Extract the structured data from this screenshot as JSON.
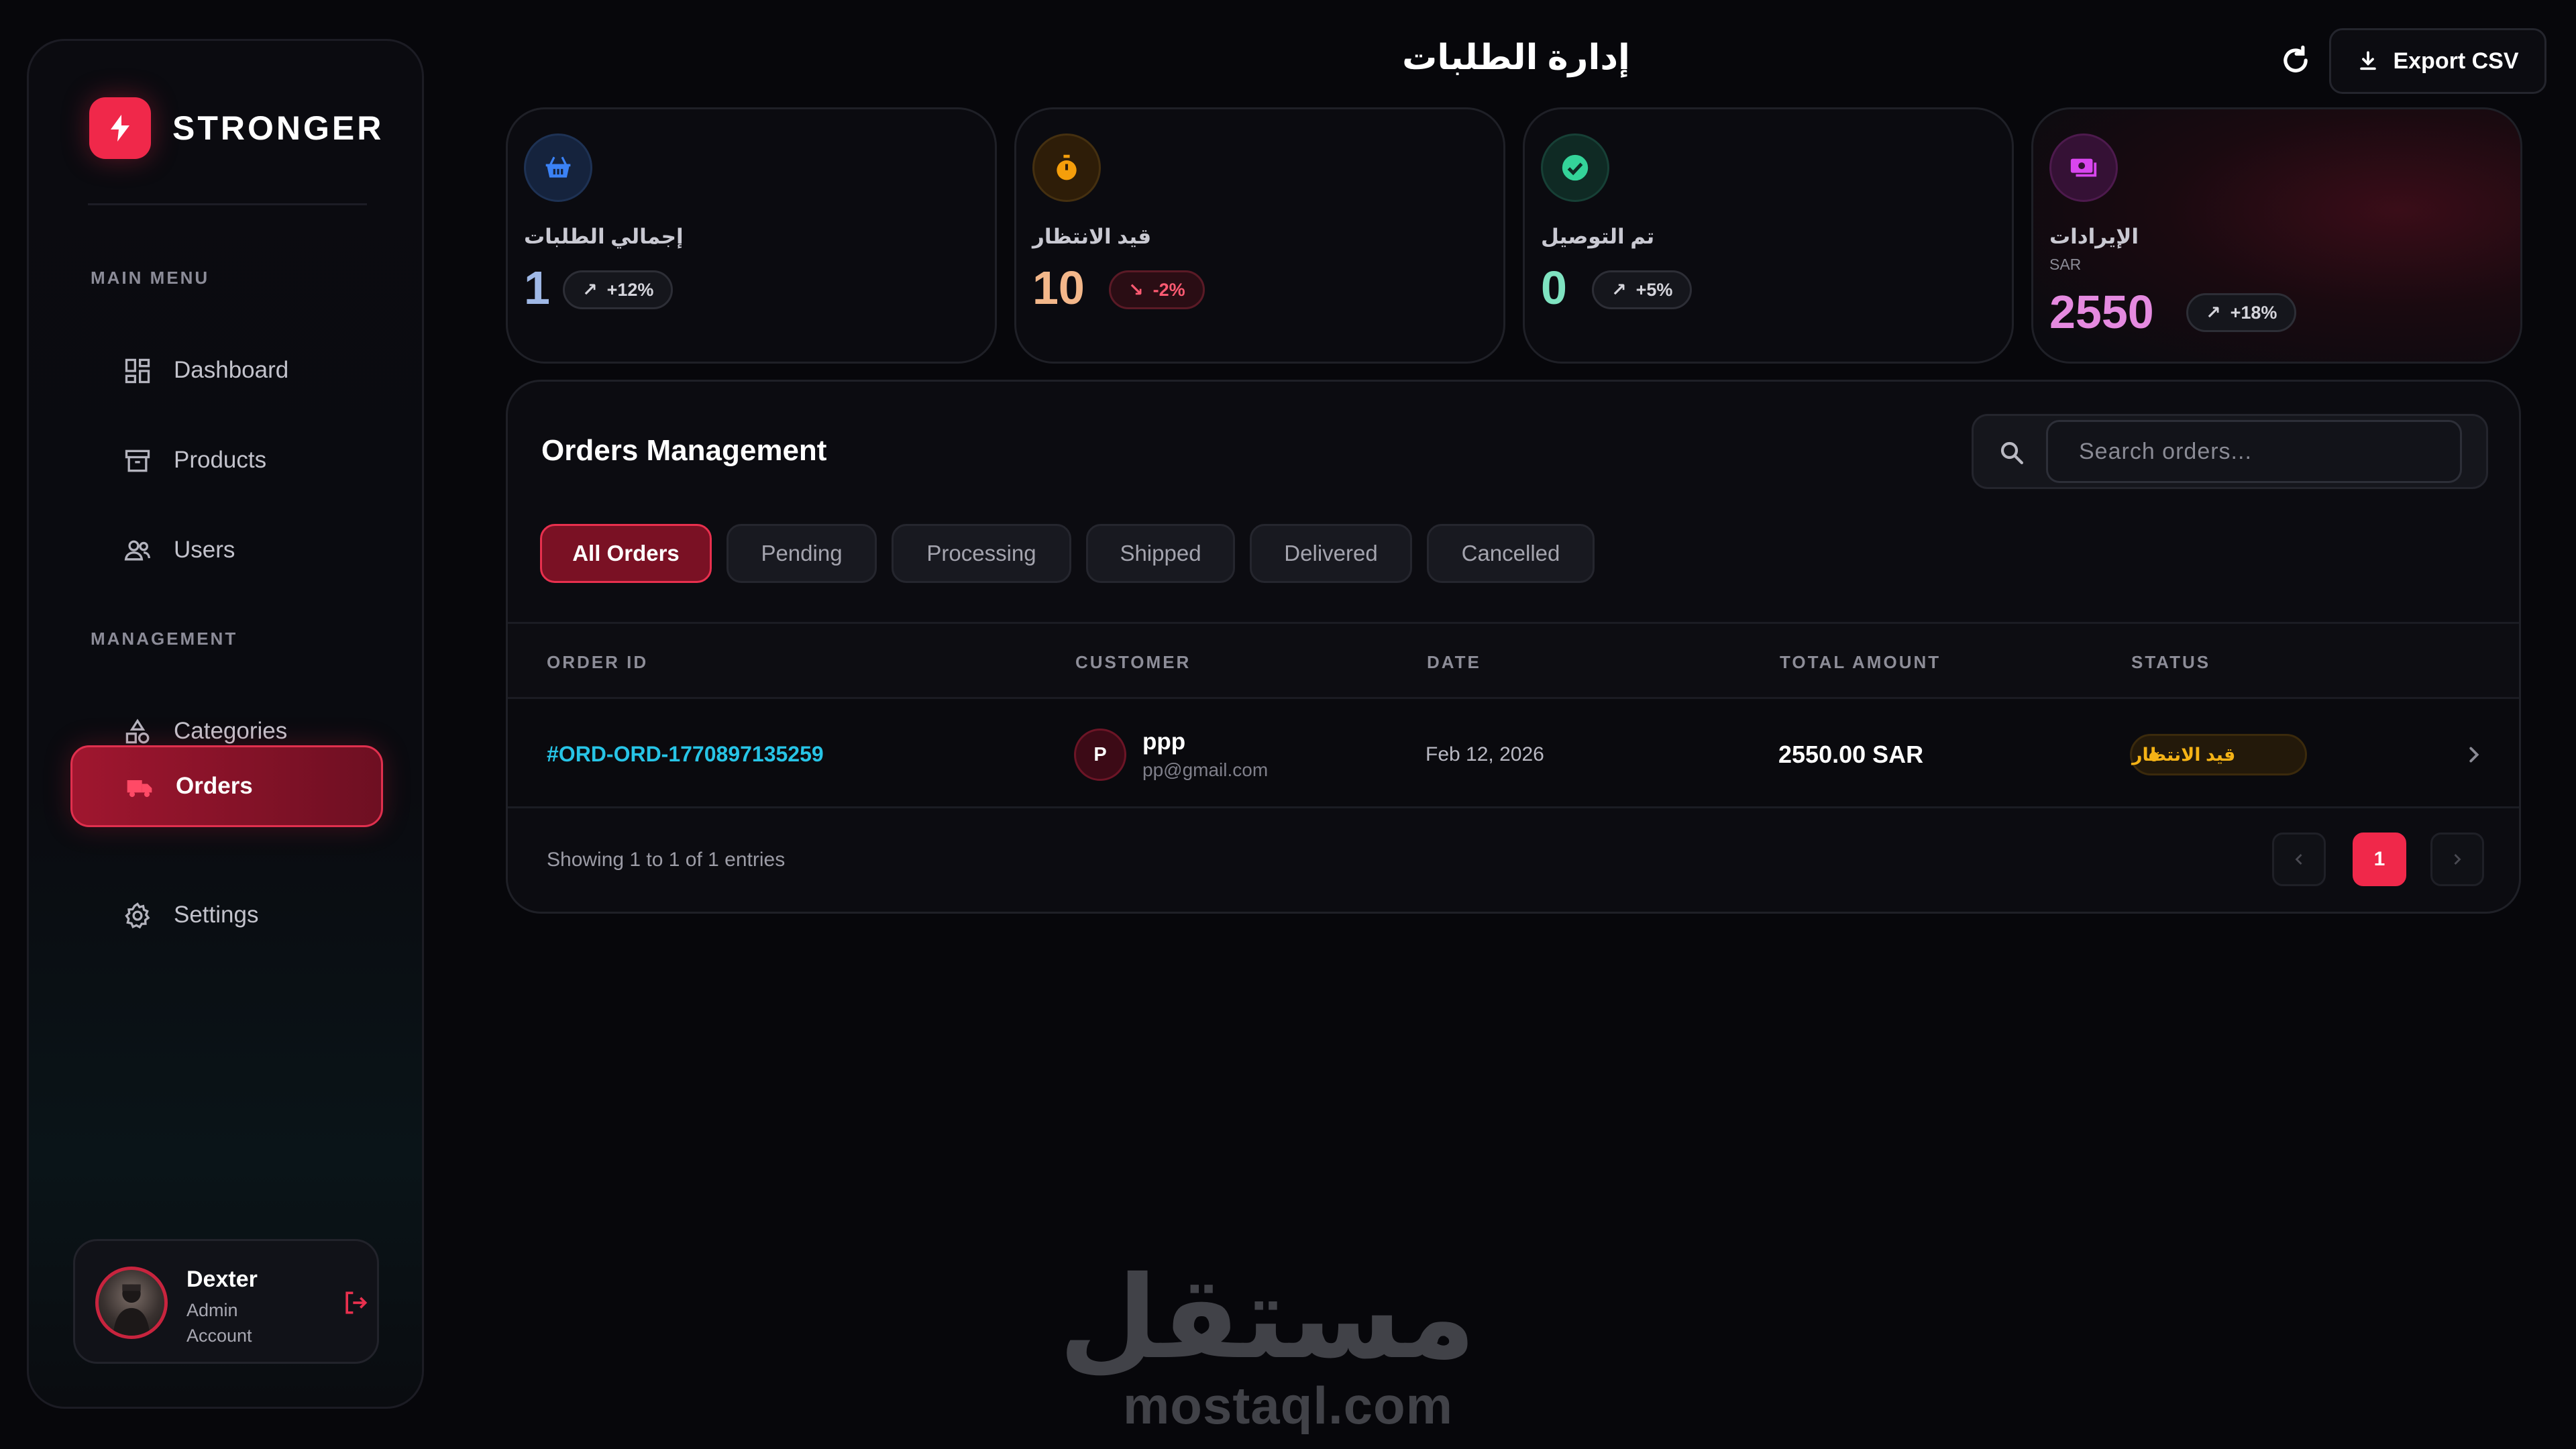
{
  "brand": {
    "name": "STRONGER",
    "accent": "#f0284a"
  },
  "sidebar": {
    "main_menu_label": "MAIN MENU",
    "management_label": "MANAGEMENT",
    "items": [
      {
        "label": "Dashboard",
        "icon": "dashboard-grid-icon"
      },
      {
        "label": "Products",
        "icon": "archive-box-icon"
      },
      {
        "label": "Users",
        "icon": "users-icon"
      },
      {
        "label": "Categories",
        "icon": "shapes-icon"
      },
      {
        "label": "Orders",
        "icon": "truck-icon",
        "active": true
      },
      {
        "label": "Settings",
        "icon": "gear-icon"
      }
    ],
    "user": {
      "name": "Dexter",
      "role": "Admin Account"
    }
  },
  "header": {
    "title": "إدارة الطلبات",
    "export_label": "Export CSV"
  },
  "stats": [
    {
      "label": "إجمالي الطلبات",
      "value": "1",
      "trend": "+12%",
      "direction": "up",
      "icon": "basket-icon",
      "color": "#3b82f6"
    },
    {
      "label": "قيد الانتظار",
      "value": "10",
      "trend": "-2%",
      "direction": "down",
      "icon": "stopwatch-icon",
      "color": "#f59e0b"
    },
    {
      "label": "تم التوصيل",
      "value": "0",
      "trend": "+5%",
      "direction": "up",
      "icon": "check-circle-icon",
      "color": "#34d399"
    },
    {
      "label": "الإيرادات",
      "unit": "SAR",
      "value": "2550",
      "trend": "+18%",
      "direction": "up",
      "icon": "money-icon",
      "color": "#d946ef"
    }
  ],
  "orders": {
    "title": "Orders Management",
    "search_placeholder": "Search orders...",
    "filters": [
      "All Orders",
      "Pending",
      "Processing",
      "Shipped",
      "Delivered",
      "Cancelled"
    ],
    "active_filter": "All Orders",
    "columns": [
      "ORDER ID",
      "CUSTOMER",
      "DATE",
      "TOTAL AMOUNT",
      "STATUS"
    ],
    "rows": [
      {
        "order_id": "#ORD-ORD-1770897135259",
        "customer_initial": "P",
        "customer_name": "ppp",
        "customer_email": "pp@gmail.com",
        "date": "Feb 12, 2026",
        "amount": "2550.00 SAR",
        "status": "قيد الانتظار"
      }
    ],
    "footer": "Showing 1 to 1 of 1 entries",
    "current_page": "1"
  },
  "watermark": {
    "arabic": "مستقل",
    "latin": "mostaql.com"
  }
}
